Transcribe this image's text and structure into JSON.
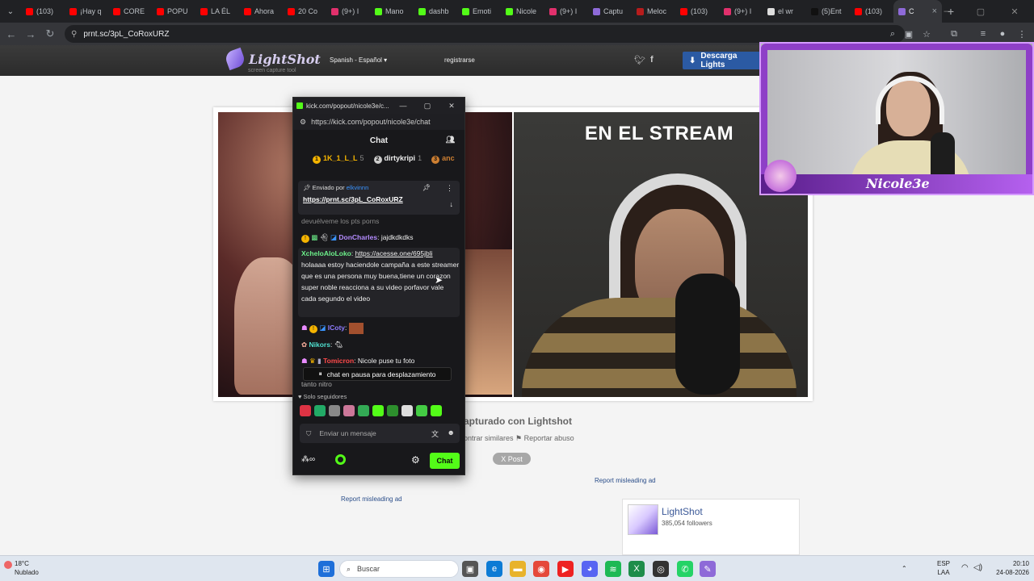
{
  "browser": {
    "tabs": [
      {
        "label": "(103)",
        "color": "#ff0000"
      },
      {
        "label": "¡Hay q",
        "color": "#ff0000"
      },
      {
        "label": "CORE",
        "color": "#ff0000"
      },
      {
        "label": "POPU",
        "color": "#ff0000"
      },
      {
        "label": "LA ÉL",
        "color": "#ff0000"
      },
      {
        "label": "Ahora",
        "color": "#ff0000"
      },
      {
        "label": "20 Co",
        "color": "#ff0000"
      },
      {
        "label": "(9+) I",
        "color": "#e1306c"
      },
      {
        "label": "Mano",
        "color": "#53fc18"
      },
      {
        "label": "dashb",
        "color": "#53fc18"
      },
      {
        "label": "Emoti",
        "color": "#53fc18"
      },
      {
        "label": "Nicole",
        "color": "#53fc18"
      },
      {
        "label": "(9+) I",
        "color": "#e1306c"
      },
      {
        "label": "Captu",
        "color": "#8e6ad8"
      },
      {
        "label": "Meloc",
        "color": "#b71c1c"
      },
      {
        "label": "(103)",
        "color": "#ff0000"
      },
      {
        "label": "(9+) I",
        "color": "#e1306c"
      },
      {
        "label": "el wr",
        "color": "#dddddd"
      },
      {
        "label": "(5)Ent",
        "color": "#111111"
      },
      {
        "label": "(103)",
        "color": "#ff0000"
      }
    ],
    "active_tab": {
      "label": "C",
      "color": "#8e6ad8"
    },
    "url": "prnt.sc/3pL_CoRoxURZ"
  },
  "lightshot": {
    "logo": "LightShot",
    "tagline": "screen capture tool",
    "language": "Spanish - Español",
    "register": "registrarse",
    "download": "Descarga Lights",
    "stream_text": "EN EL STREAM",
    "captured": "apturado con Lightshot",
    "links": "ontrar similares   ⚑ Reportar abuso",
    "post": "X Post",
    "report_ad": "Report misleading ad",
    "fb_title": "LightShot",
    "fb_followers": "385,054 followers"
  },
  "kick": {
    "window_title": "kick.com/popout/nicole3e/c...",
    "url": "https://kick.com/popout/nicole3e/chat",
    "header": "Chat",
    "top_gifters": [
      {
        "name": "1K_1_L_L",
        "count": "5",
        "color": "#f5b400"
      },
      {
        "name": "dirtykripi",
        "count": "1",
        "color": "#cccccc"
      },
      {
        "name": "anc",
        "count": "",
        "color": "#cd7f32"
      }
    ],
    "pinned": {
      "sent_by_label": "Enviado por",
      "user": "elkvinnn",
      "link": "https://prnt.sc/3pL_CoRoxURZ"
    },
    "partial_text": "devuélveme los pts porns",
    "messages": [
      {
        "user": "DonCharles",
        "color": "#b48cff",
        "text": "jajdkdkdks"
      },
      {
        "user": "XcheloAloLoko",
        "color": "#6cf08a",
        "link": "https://acesse.one/695jbli",
        "text": "holaaaa estoy haciendole campaña a este streamer que es una persona muy buena,tiene un corazon super noble reacciona a su video porfavor vale cada segundo el video"
      },
      {
        "user": "lCoty",
        "color": "#8f7dff",
        "text": ""
      },
      {
        "user": "Nikors",
        "color": "#4fe0d0",
        "text": ""
      },
      {
        "user": "Tomicron",
        "color": "#ff4a4a",
        "text": "Nicole puse tu foto"
      }
    ],
    "tail_text": "tanto nitro",
    "paused": "chat en pausa para desplazamiento",
    "followers_only": "Solo seguidores",
    "input_placeholder": "Enviar un mensaje",
    "chat_button": "Chat"
  },
  "webcam": {
    "name": "Nicole3e"
  },
  "taskbar": {
    "temp": "18°C",
    "weather": "Nublado",
    "search": "Buscar",
    "lang1": "ESP",
    "lang2": "LAA",
    "time": "20:10",
    "date": "24-08-2026"
  }
}
